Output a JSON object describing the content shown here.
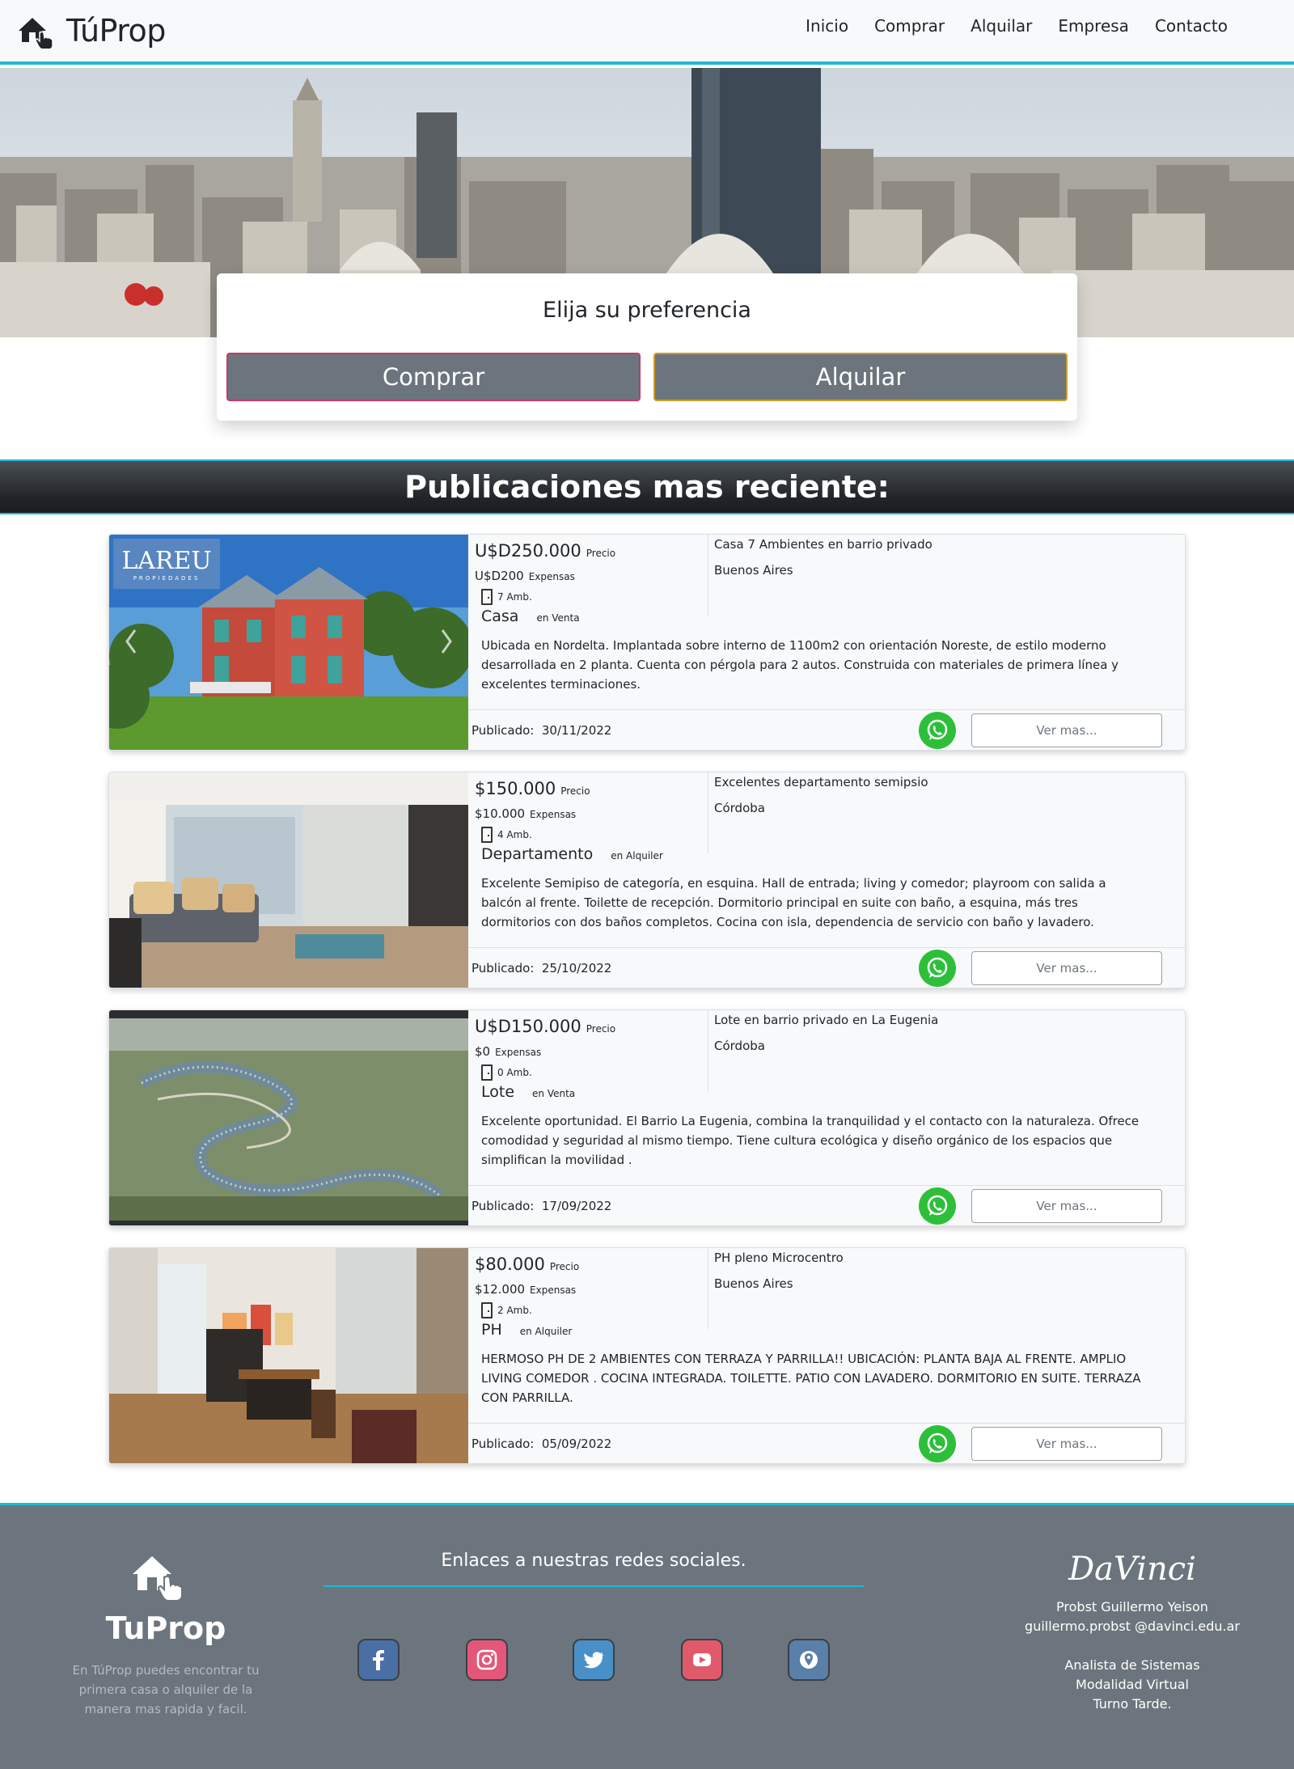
{
  "nav": {
    "brand": "TúProp",
    "links": [
      "Inicio",
      "Comprar",
      "Alquilar",
      "Empresa",
      "Contacto"
    ]
  },
  "search": {
    "title": "Elija su preferencia",
    "buy_label": "Comprar",
    "rent_label": "Alquilar"
  },
  "section_title": "Publicaciones mas reciente:",
  "listings": [
    {
      "price": "U$D250.000",
      "price_label": "Precio",
      "expenses": "U$D200",
      "expenses_label": "Expensas",
      "rooms": "7 Amb.",
      "type": "Casa",
      "operation": "en Venta",
      "title": "Casa 7 Ambientes en barrio privado",
      "location": "Buenos Aires",
      "description": "Ubicada en Nordelta. Implantada sobre interno de 1100m2 con orientación Noreste, de estilo moderno desarrollada en 2 planta. Cuenta con pérgola para 2 autos. Construida con materiales de primera línea y excelentes terminaciones.",
      "published_label": "Publicado:",
      "published": "30/11/2022",
      "more": "Ver mas...",
      "watermark": "LAREU",
      "watermark_sub": "PROPIEDADES"
    },
    {
      "price": "$150.000",
      "price_label": "Precio",
      "expenses": "$10.000",
      "expenses_label": "Expensas",
      "rooms": "4 Amb.",
      "type": "Departamento",
      "operation": "en Alquiler",
      "title": "Excelentes departamento semipsio",
      "location": "Córdoba",
      "description": "Excelente Semipiso de categoría, en esquina. Hall de entrada; living y comedor; playroom con salida a balcón al frente. Toilette de recepción. Dormitorio principal en suite con baño, a esquina, más tres dormitorios con dos baños completos. Cocina con isla, dependencia de servicio con baño y lavadero.",
      "published_label": "Publicado:",
      "published": "25/10/2022",
      "more": "Ver mas..."
    },
    {
      "price": "U$D150.000",
      "price_label": "Precio",
      "expenses": "$0",
      "expenses_label": "Expensas",
      "rooms": "0 Amb.",
      "type": "Lote",
      "operation": "en Venta",
      "title": "Lote en barrio privado en La Eugenia",
      "location": "Córdoba",
      "description": "Excelente oportunidad. El Barrio La Eugenia, combina la tranquilidad y el contacto con la naturaleza. Ofrece comodidad y seguridad al mismo tiempo. Tiene cultura ecológica y diseño orgánico de los espacios que simplifican la movilidad .",
      "published_label": "Publicado:",
      "published": "17/09/2022",
      "more": "Ver mas..."
    },
    {
      "price": "$80.000",
      "price_label": "Precio",
      "expenses": "$12.000",
      "expenses_label": "Expensas",
      "rooms": "2 Amb.",
      "type": "PH",
      "operation": "en Alquiler",
      "title": "PH pleno Microcentro",
      "location": "Buenos Aires",
      "description": "HERMOSO PH DE 2 AMBIENTES CON TERRAZA Y PARRILLA!! UBICACIÓN: PLANTA BAJA AL FRENTE. AMPLIO LIVING COMEDOR . COCINA INTEGRADA. TOILETTE. PATIO CON LAVADERO. DORMITORIO EN SUITE. TERRAZA CON PARRILLA.",
      "published_label": "Publicado:",
      "published": "05/09/2022",
      "more": "Ver mas..."
    }
  ],
  "footer": {
    "brand": "TuProp",
    "tagline": "En TúProp puedes encontrar tu primera casa o alquiler de la manera mas rapida y facil.",
    "links_title": "Enlaces a nuestras redes sociales.",
    "social": [
      "facebook",
      "instagram",
      "twitter",
      "youtube",
      "location"
    ],
    "davinci": "DaVinci",
    "author": "Probst Guillermo Yeison",
    "email": "guillermo.probst @davinci.edu.ar",
    "career": "Analista de Sistemas",
    "modality": "Modalidad Virtual",
    "shift": "Turno Tarde."
  },
  "colors": {
    "accent": "#1fb8d6",
    "button": "#6c757d",
    "whatsapp": "#2dbf3a",
    "footer": "#6c757d"
  }
}
